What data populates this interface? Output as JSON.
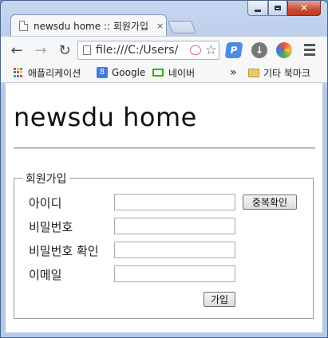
{
  "browser": {
    "tab": {
      "title": "newsdu home :: 회원가입",
      "close": "×"
    },
    "toolbar": {
      "url": "file:///C:/Users/"
    },
    "bookmarks": {
      "items": [
        {
          "label": "애플리케이션",
          "icon": "apps-icon"
        },
        {
          "label": "Google",
          "icon": "google-icon"
        },
        {
          "label": "네이버",
          "icon": "naver-icon"
        }
      ],
      "overflow": "»",
      "other": "기타 북마크"
    },
    "icons": {
      "back": "back-arrow-icon",
      "forward": "forward-arrow-icon",
      "reload": "reload-icon",
      "star": "star-icon",
      "menu": "menu-icon"
    }
  },
  "page": {
    "title": "newsdu home",
    "form": {
      "legend": "회원가입",
      "fields": [
        {
          "label": "아이디",
          "value": ""
        },
        {
          "label": "비밀번호",
          "value": ""
        },
        {
          "label": "비밀번호 확인",
          "value": ""
        },
        {
          "label": "이메일",
          "value": ""
        }
      ],
      "check_button": "중복확인",
      "submit_button": "가입"
    }
  },
  "colors": {
    "frame": "#b6cae8",
    "naver_green": "#2db400",
    "google_blue": "#3f7be0"
  }
}
